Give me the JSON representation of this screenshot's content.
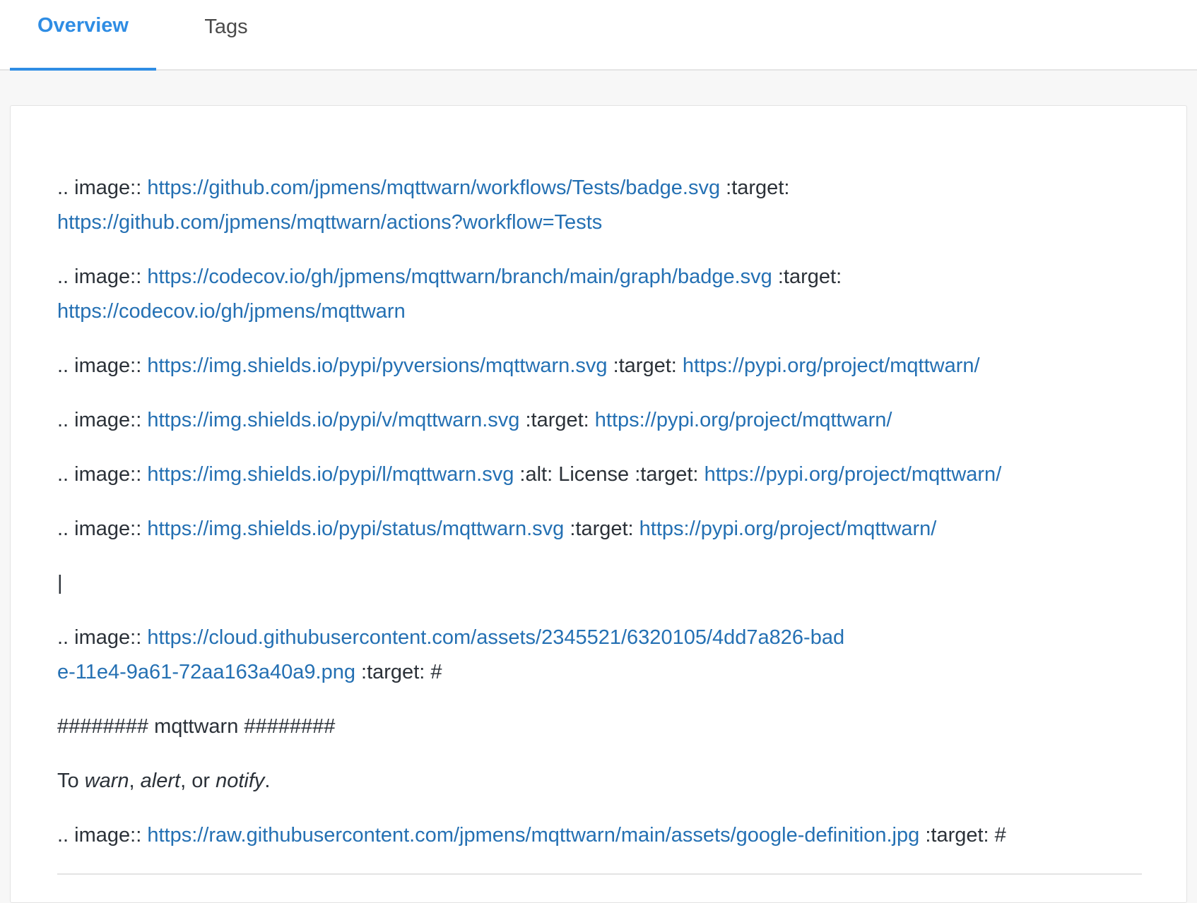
{
  "tabs": [
    {
      "label": "Overview",
      "active": true
    },
    {
      "label": "Tags",
      "active": false
    }
  ],
  "colors": {
    "accent": "#2f8de4",
    "link": "#2470b3",
    "text": "#2b3138"
  },
  "readme": {
    "prefix": ".. image::",
    "target_label": ":target:",
    "blocks": [
      {
        "url": "https://github.com/jpmens/mqttwarn/workflows/Tests/badge.svg",
        "target": "https://github.com/jpmens/mqttwarn/actions?workflow=Tests"
      },
      {
        "url": "https://codecov.io/gh/jpmens/mqttwarn/branch/main/graph/badge.svg",
        "target": "https://codecov.io/gh/jpmens/mqttwarn"
      },
      {
        "url": "https://img.shields.io/pypi/pyversions/mqttwarn.svg",
        "target": "https://pypi.org/project/mqttwarn/"
      },
      {
        "url": "https://img.shields.io/pypi/v/mqttwarn.svg",
        "target": "https://pypi.org/project/mqttwarn/"
      },
      {
        "url": "https://img.shields.io/pypi/l/mqttwarn.svg",
        "alt_text": ":alt: License",
        "target": "https://pypi.org/project/mqttwarn/"
      },
      {
        "url": "https://img.shields.io/pypi/status/mqttwarn.svg",
        "target": "https://pypi.org/project/mqttwarn/"
      }
    ],
    "pipe": "|",
    "logo": {
      "url": "https://cloud.githubusercontent.com/assets/2345521/6320105/4dd7a826-bade-11e4-9a61-72aa163a40a9.png",
      "target": "#"
    },
    "heading": "######## mqttwarn ########",
    "tagline": {
      "prefix": "To ",
      "w1": "warn",
      "sep1": ", ",
      "w2": "alert",
      "sep2": ", or ",
      "w3": "notify",
      "suffix": "."
    },
    "definition": {
      "url": "https://raw.githubusercontent.com/jpmens/mqttwarn/main/assets/google-definition.jpg",
      "target": "#"
    }
  }
}
